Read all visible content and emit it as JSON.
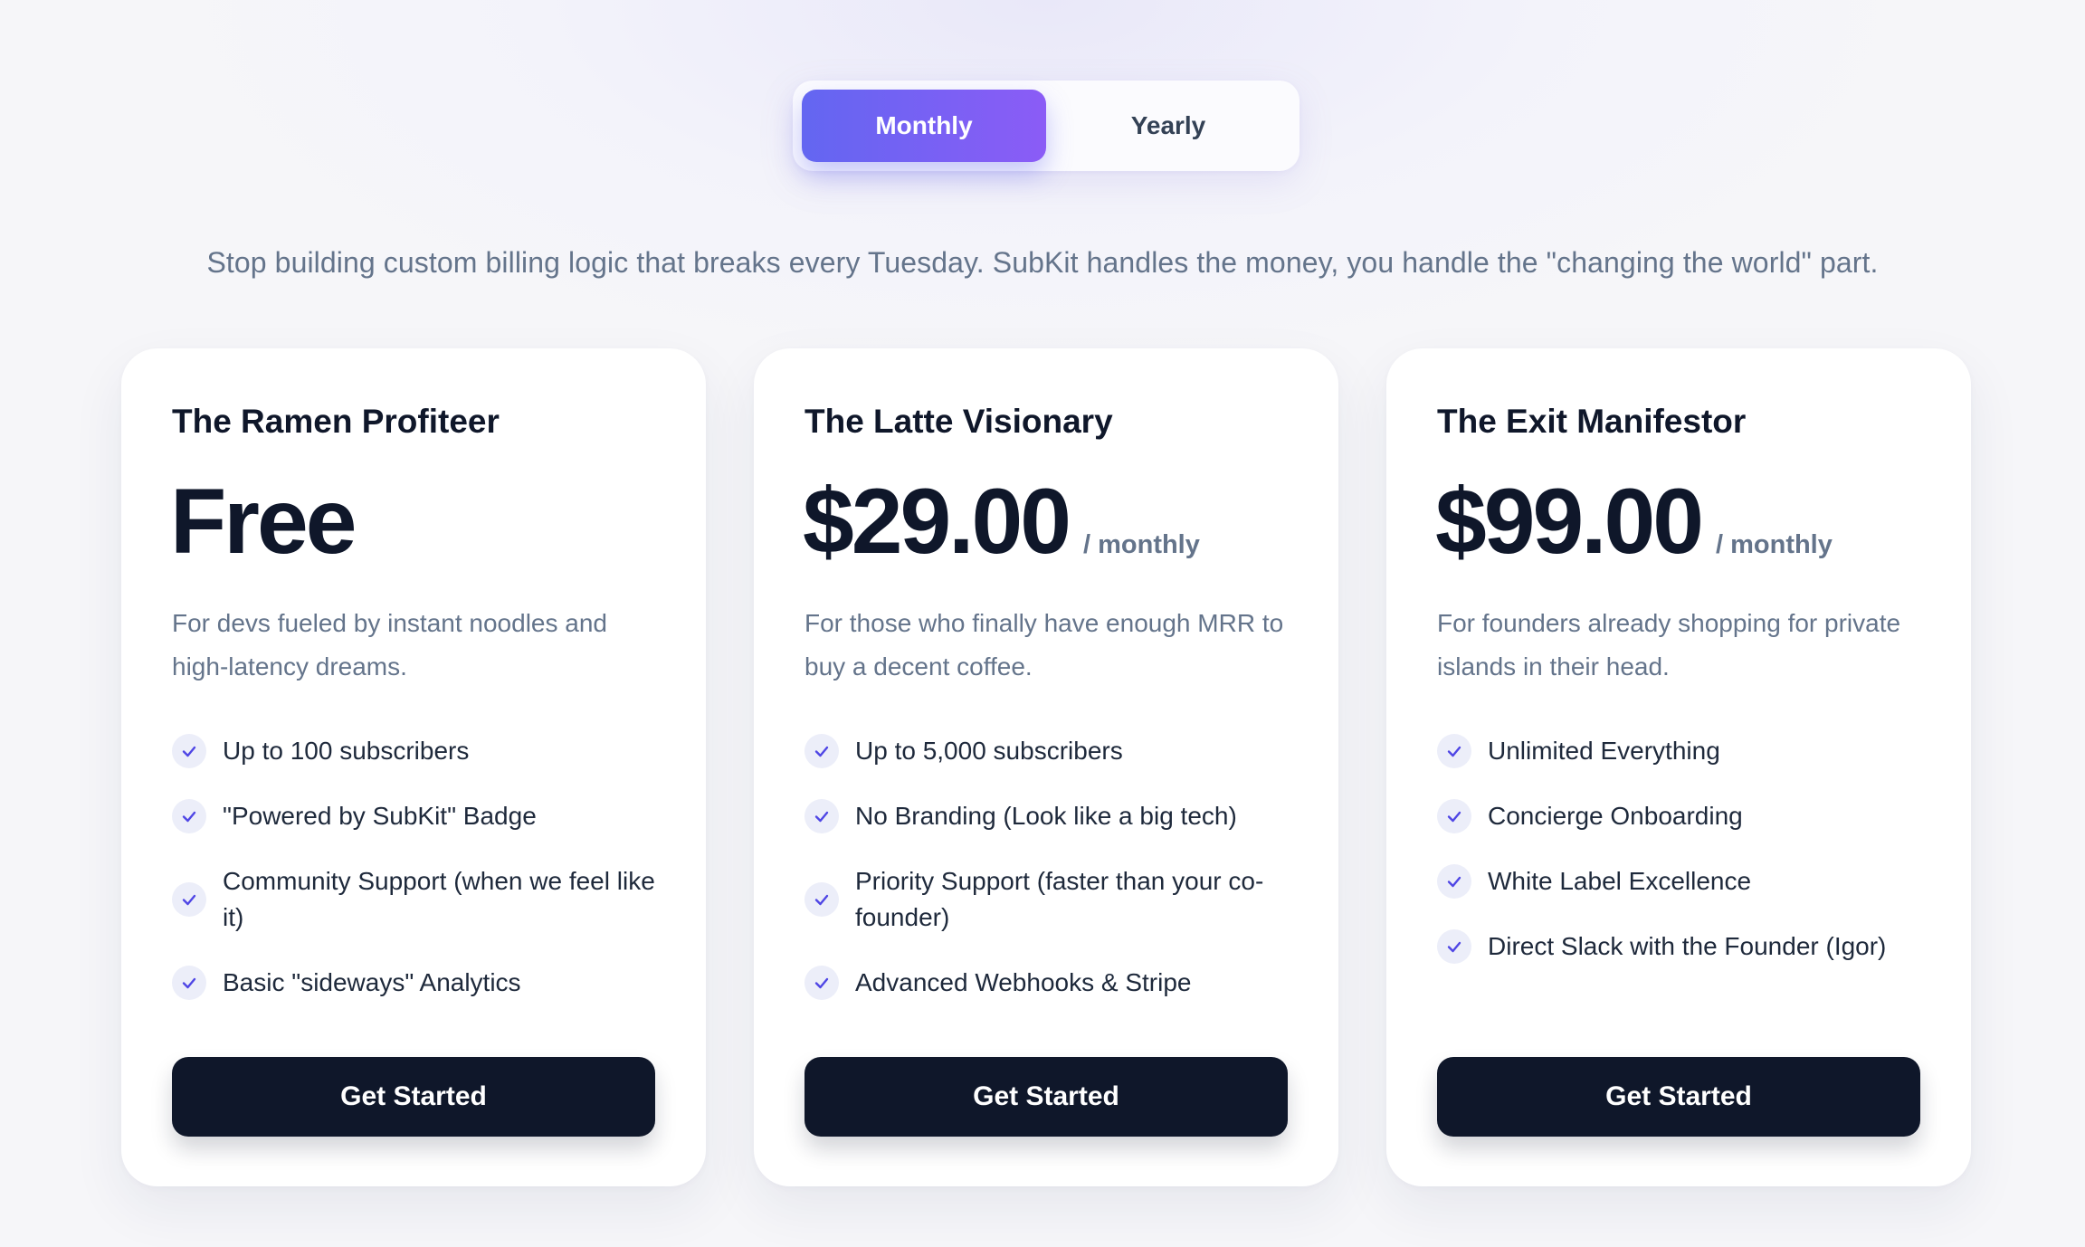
{
  "billing_toggle": {
    "monthly_label": "Monthly",
    "yearly_label": "Yearly",
    "selected": "Monthly"
  },
  "tagline": "Stop building custom billing logic that breaks every Tuesday. SubKit handles the money, you handle the \"changing the world\" part.",
  "plans": [
    {
      "name": "The Ramen Profiteer",
      "price": "Free",
      "period": "",
      "description": "For devs fueled by instant noodles and high-latency dreams.",
      "features": [
        "Up to 100 subscribers",
        "\"Powered by SubKit\" Badge",
        "Community Support (when we feel like it)",
        "Basic \"sideways\" Analytics"
      ],
      "cta": "Get Started"
    },
    {
      "name": "The Latte Visionary",
      "price": "$29.00",
      "period": "/ monthly",
      "description": "For those who finally have enough MRR to buy a decent coffee.",
      "features": [
        "Up to 5,000 subscribers",
        "No Branding (Look like a big tech)",
        "Priority Support (faster than your co-founder)",
        "Advanced Webhooks & Stripe"
      ],
      "cta": "Get Started"
    },
    {
      "name": "The Exit Manifestor",
      "price": "$99.00",
      "period": "/ monthly",
      "description": "For founders already shopping for private islands in their head.",
      "features": [
        "Unlimited Everything",
        "Concierge Onboarding",
        "White Label Excellence",
        "Direct Slack with the Founder (Igor)"
      ],
      "cta": "Get Started"
    }
  ],
  "icons": {
    "feature_bullet": "check-icon"
  },
  "colors": {
    "accent_start": "#6366f1",
    "accent_end": "#8b5cf6",
    "button_dark": "#0f172a",
    "check_color": "#4f46e5",
    "muted_text": "#64748b"
  }
}
